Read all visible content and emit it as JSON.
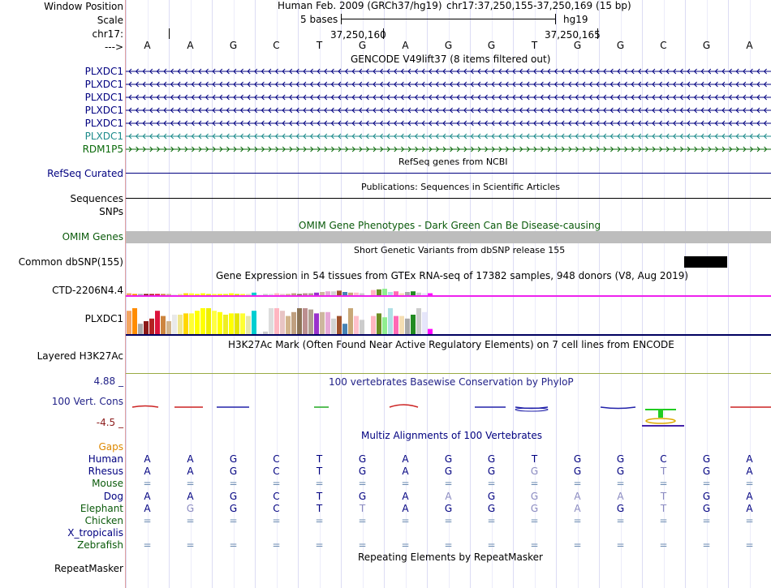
{
  "header": {
    "window_position_label": "Window Position",
    "scale_label": "Scale",
    "chrom_label": "chr17:",
    "arrow_label": "--->",
    "assembly_text": "Human Feb. 2009 (GRCh37/hg19)",
    "position_text": "chr17:37,250,155-37,250,169 (15 bp)",
    "scale_text": "5 bases",
    "db_text": "hg19",
    "coord1": "37,250,160",
    "coord2": "37,250,165"
  },
  "sequence": [
    "A",
    "A",
    "G",
    "C",
    "T",
    "G",
    "A",
    "G",
    "G",
    "T",
    "G",
    "G",
    "C",
    "G",
    "A"
  ],
  "gencode": {
    "title": "GENCODE V49lift37 (8 items filtered out)",
    "genes": [
      {
        "name": "PLXDC1",
        "color": "#000080",
        "strand": "minus"
      },
      {
        "name": "PLXDC1",
        "color": "#000080",
        "strand": "minus"
      },
      {
        "name": "PLXDC1",
        "color": "#000080",
        "strand": "minus"
      },
      {
        "name": "PLXDC1",
        "color": "#000080",
        "strand": "minus"
      },
      {
        "name": "PLXDC1",
        "color": "#000080",
        "strand": "minus"
      },
      {
        "name": "PLXDC1",
        "color": "#1b8a8a",
        "strand": "minus"
      },
      {
        "name": "RDM1P5",
        "color": "#0a6a0a",
        "strand": "plus"
      }
    ]
  },
  "refseq": {
    "label": "RefSeq Curated",
    "title": "RefSeq genes from NCBI"
  },
  "pubs": {
    "label": "Sequences",
    "title": "Publications: Sequences in Scientific Articles",
    "snps_label": "SNPs"
  },
  "omim": {
    "title": "OMIM Gene Phenotypes - Dark Green Can Be Disease-causing",
    "label": "OMIM Genes",
    "title_color": "#0a5a0a",
    "label_color": "#0a5a0a"
  },
  "dbsnp": {
    "title": "Short Genetic Variants from dbSNP release 155",
    "label": "Common dbSNP(155)"
  },
  "gtex": {
    "title": "Gene Expression in 54 tissues from GTEx RNA-seq of 17382 samples, 948 donors (V8, Aug 2019)",
    "gene1": "CTD-2206N4.4",
    "gene2": "PLXDC1",
    "tissue_colors": [
      "#f4a460",
      "#ff8c00",
      "#a9a9a9",
      "#8b1a1a",
      "#b22222",
      "#dc143c",
      "#cd853f",
      "#d2b48c",
      "#e9e9e9",
      "#f0e68c",
      "#ffd700",
      "#ffff33",
      "#ffff00",
      "#ffff00",
      "#eeee00",
      "#ffff44",
      "#ffff00",
      "#eeee22",
      "#ffff00",
      "#e5e500",
      "#ffff33",
      "#e6e6aa",
      "#00ced1",
      "#eeeeee",
      "#cccccc",
      "#dddddd",
      "#ffb6c1",
      "#e8c4c4",
      "#d2b48c",
      "#c0a080",
      "#8b7355",
      "#bc8f8f",
      "#b0a090",
      "#9932cc",
      "#cdb79e",
      "#e6a8d7",
      "#d3d3d3",
      "#a0522d",
      "#4682b4",
      "#c8a878",
      "#ffc0cb",
      "#cccccc",
      "#ffffff",
      "#ffb6c1",
      "#6b8e23",
      "#90ee90",
      "#b0e0e6",
      "#ff69b4",
      "#f5deb3",
      "#a9a9a9",
      "#228b22",
      "#cccccc",
      "#e6e6fa",
      "#ff00ff"
    ],
    "gene1_values": [
      0.3,
      0.2,
      0.2,
      0.2,
      0.2,
      0.2,
      0.2,
      0.2,
      0.15,
      0.2,
      0.3,
      0.3,
      0.2,
      0.3,
      0.2,
      0.2,
      0.2,
      0.2,
      0.3,
      0.2,
      0.2,
      0.2,
      0.4,
      0.1,
      0.2,
      0.2,
      0.3,
      0.2,
      0.2,
      0.3,
      0.2,
      0.3,
      0.3,
      0.4,
      0.5,
      0.6,
      0.6,
      0.7,
      0.5,
      0.4,
      0.4,
      0.3,
      0.3,
      0.8,
      0.9,
      1.0,
      0.5,
      0.6,
      0.3,
      0.5,
      0.6,
      0.4,
      0.3,
      0.3,
      0.5
    ],
    "gene2_values": [
      0.9,
      1.0,
      0.4,
      0.5,
      0.6,
      0.9,
      0.7,
      0.5,
      0.75,
      0.75,
      0.8,
      0.8,
      0.9,
      1.0,
      1.0,
      0.9,
      0.85,
      0.75,
      0.8,
      0.8,
      0.8,
      0.7,
      0.9,
      0.05,
      0.1,
      1.0,
      1.0,
      0.9,
      0.7,
      0.85,
      1.0,
      1.0,
      0.95,
      0.8,
      0.85,
      0.85,
      0.6,
      0.7,
      0.4,
      1.0,
      0.7,
      0.55,
      0.6,
      0.7,
      0.8,
      0.65,
      1.0,
      0.7,
      0.7,
      0.6,
      0.75,
      1.0,
      0.85,
      0.2
    ]
  },
  "h3k27ac": {
    "label": "Layered H3K27Ac",
    "title": "H3K27Ac Mark (Often Found Near Active Regulatory Elements) on 7 cell lines from ENCODE"
  },
  "phylop": {
    "title": "100 vertebrates Basewise Conservation by PhyloP",
    "label": "100 Vert. Cons",
    "max_label": "4.88 _",
    "min_label": "-4.5 _"
  },
  "multiz": {
    "title": "Multiz Alignments of 100 Vertebrates",
    "gaps_label": "Gaps",
    "species": [
      {
        "name": "Human",
        "color": "#000080",
        "bases": [
          "A",
          "A",
          "G",
          "C",
          "T",
          "G",
          "A",
          "G",
          "G",
          "T",
          "G",
          "G",
          "C",
          "G",
          "A"
        ],
        "faint": []
      },
      {
        "name": "Rhesus",
        "color": "#000080",
        "bases": [
          "A",
          "A",
          "G",
          "C",
          "T",
          "G",
          "A",
          "G",
          "G",
          "G",
          "G",
          "G",
          "T",
          "G",
          "A"
        ],
        "faint": [
          9,
          12
        ]
      },
      {
        "name": "Mouse",
        "color": "#0a5a0a",
        "bases": [
          "=",
          "=",
          "=",
          "=",
          "=",
          "=",
          "=",
          "=",
          "=",
          "=",
          "=",
          "=",
          "=",
          "=",
          "="
        ],
        "faint": []
      },
      {
        "name": "Dog",
        "color": "#000080",
        "bases": [
          "A",
          "A",
          "G",
          "C",
          "T",
          "G",
          "A",
          "A",
          "G",
          "G",
          "A",
          "A",
          "T",
          "G",
          "A"
        ],
        "faint": [
          7,
          9,
          10,
          11,
          12
        ]
      },
      {
        "name": "Elephant",
        "color": "#0a5a0a",
        "bases": [
          "A",
          "G",
          "G",
          "C",
          "T",
          "T",
          "A",
          "G",
          "G",
          "G",
          "A",
          "G",
          "T",
          "G",
          "A"
        ],
        "faint": [
          1,
          5,
          9,
          10,
          12
        ]
      },
      {
        "name": "Chicken",
        "color": "#0a5a0a",
        "bases": [
          "=",
          "=",
          "=",
          "=",
          "=",
          "=",
          "=",
          "=",
          "=",
          "=",
          "=",
          "=",
          "=",
          "=",
          "="
        ],
        "faint": []
      },
      {
        "name": "X_tropicalis",
        "color": "#000080",
        "bases": [
          "",
          "",
          "",
          "",
          "",
          "",
          "",
          "",
          "",
          "",
          "",
          "",
          "",
          "",
          ""
        ],
        "faint": []
      },
      {
        "name": "Zebrafish",
        "color": "#0a5a0a",
        "bases": [
          "=",
          "=",
          "=",
          "=",
          "=",
          "=",
          "=",
          "=",
          "=",
          "=",
          "=",
          "=",
          "=",
          "=",
          "="
        ],
        "faint": []
      }
    ]
  },
  "repeatmasker": {
    "title": "Repeating Elements by RepeatMasker",
    "label": "RepeatMasker"
  }
}
